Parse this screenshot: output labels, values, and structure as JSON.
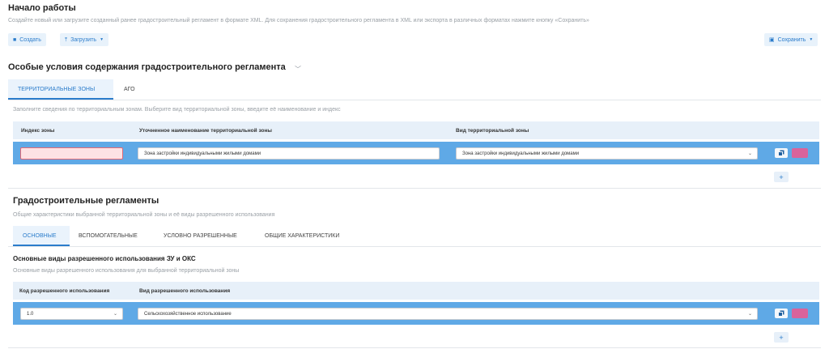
{
  "header": {
    "title": "Начало работы",
    "subtitle": "Создайте новый или загрузите созданный ранее градостроительный регламент в формате XML. Для сохранения градостроительного регламента в XML или экспорта в различных форматах нажмите кнопку «Сохранить»",
    "create_label": "Создать",
    "upload_label": "Загрузить",
    "save_label": "Сохранить"
  },
  "special": {
    "title": "Особые условия содержания градостроительного регламента",
    "tabs": [
      "ТЕРРИТОРИАЛЬНЫЕ ЗОНЫ",
      "АГО"
    ],
    "hint": "Заполните сведения по территориальным зонам. Выберите вид территориальной зоны, введите её наименование и индекс",
    "columns": [
      "Индекс зоны",
      "Уточненное наименование территориальной зоны",
      "Вид территориальной зоны"
    ],
    "row": {
      "index": "",
      "name": "Зона застройки индивидуальными жилыми домами",
      "type": "Зона застройки индивидуальными жилыми домами"
    },
    "add_label": "+"
  },
  "regulations": {
    "title": "Градостроительные регламенты",
    "hint": "Общие характеристики выбранной территориальной зоны и её виды разрешенного использования",
    "tabs": [
      "ОСНОВНЫЕ",
      "ВСПОМОГАТЕЛЬНЫЕ",
      "УСЛОВНО РАЗРЕШЕННЫЕ",
      "ОБЩИЕ ХАРАКТЕРИСТИКИ"
    ],
    "sub_title": "Основные виды разрешенного использования ЗУ и ОКС",
    "sub_hint": "Основные виды разрешенного использования для выбранной территориальной зоны",
    "columns": [
      "Код разрешенного использования",
      "Вид разрешенного использования"
    ],
    "row": {
      "code": "1.0",
      "kind": "Сельскохозяйственное использование"
    },
    "add_label": "+"
  },
  "colors": {
    "accent": "#2b7ccb",
    "row_highlight": "#5fa9e6",
    "delete": "#d9639b",
    "header_bg": "#e7f0f9"
  },
  "icons": [
    "square-icon",
    "upload-icon",
    "save-icon",
    "chevron-down-icon",
    "copy-icon",
    "delete-icon",
    "plus-icon"
  ]
}
